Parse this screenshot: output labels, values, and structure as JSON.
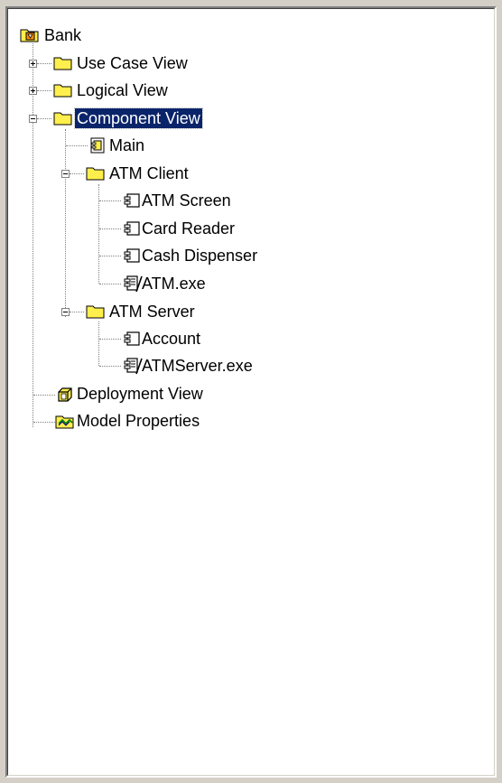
{
  "colors": {
    "selection": "#0a246a",
    "folder": "#ffef4d",
    "panel_bg": "#d4d0c8"
  },
  "tree": {
    "root": {
      "label": "Bank",
      "icon": "model-icon"
    },
    "use_case_view": {
      "label": "Use Case View",
      "icon": "folder-icon",
      "state": "collapsed"
    },
    "logical_view": {
      "label": "Logical View",
      "icon": "folder-icon",
      "state": "collapsed"
    },
    "component_view": {
      "label": "Component View",
      "icon": "folder-icon",
      "state": "expanded",
      "selected": true
    },
    "main": {
      "label": "Main",
      "icon": "component-diagram-icon"
    },
    "atm_client": {
      "label": "ATM Client",
      "icon": "folder-icon",
      "state": "expanded"
    },
    "atm_screen": {
      "label": "ATM Screen",
      "icon": "component-icon"
    },
    "card_reader": {
      "label": "Card Reader",
      "icon": "component-icon"
    },
    "cash_dispenser": {
      "label": "Cash Dispenser",
      "icon": "component-icon"
    },
    "atm_exe": {
      "label": "ATM.exe",
      "icon": "executable-component-icon"
    },
    "atm_server": {
      "label": "ATM Server",
      "icon": "folder-icon",
      "state": "expanded"
    },
    "account": {
      "label": "Account",
      "icon": "component-icon"
    },
    "atmserver_exe": {
      "label": "ATMServer.exe",
      "icon": "executable-component-icon"
    },
    "deployment_view": {
      "label": "Deployment View",
      "icon": "deployment-icon"
    },
    "model_properties": {
      "label": "Model Properties",
      "icon": "model-properties-icon"
    }
  }
}
